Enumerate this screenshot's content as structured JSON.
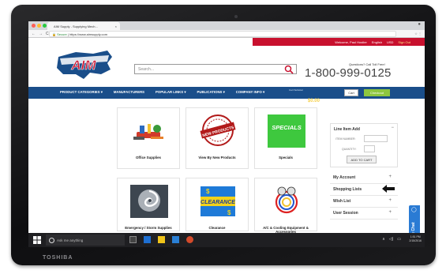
{
  "device": {
    "brand": "TOSHIBA"
  },
  "browser": {
    "tab_title": "AIM Supply - Supplying Mech...",
    "tab_close": "×",
    "url_secure": "Secure",
    "url": "https://www.aimsupply.com",
    "nav_back": "←",
    "nav_forward": "→",
    "nav_reload": "C"
  },
  "header": {
    "welcome": "Welcome, Paul Hostler",
    "language": "English",
    "currency": "USD",
    "sign_out": "Sign Out",
    "search_placeholder": "Search...",
    "call_label": "Questions? Call Toll Free!",
    "phone": "1-800-999-0125"
  },
  "nav": {
    "items": [
      {
        "label": "PRODUCT CATEGORIES ▾"
      },
      {
        "label": "MANUFACTURERS"
      },
      {
        "label": "POPULAR LINKS ▾"
      },
      {
        "label": "PUBLICATIONS ▾"
      },
      {
        "label": "COMPANY INFO ▾"
      }
    ],
    "cart_label": "Cart Subtotal",
    "cart_items": "0 item(s)",
    "cart_total": "$0.00",
    "cart_button": "Cart",
    "checkout_button": "Checkout"
  },
  "products": [
    {
      "caption": "Office Supplies"
    },
    {
      "caption": "View By New Products",
      "badge": "NEW PRODUCTS"
    },
    {
      "caption": "Specials",
      "badge": "SPECIALS"
    },
    {
      "caption": "Emergency / Storm Supplies"
    },
    {
      "caption": "Clearance",
      "badge": "CLEARANCE"
    },
    {
      "caption": "A/C & Cooling Equipment & Accessories"
    }
  ],
  "sidebar": {
    "line_item_title": "Line Item Add",
    "item_label": "ITEM NUMBER:",
    "qty_label": "QUANTITY:",
    "add_button": "ADD TO CART",
    "menu": [
      {
        "label": "My Account",
        "plus": "+"
      },
      {
        "label": "Shopping Lists",
        "plus": ""
      },
      {
        "label": "Wish List",
        "plus": "+"
      },
      {
        "label": "User Session",
        "plus": "+"
      }
    ]
  },
  "livechat": {
    "label": "Live Chat"
  },
  "taskbar": {
    "search_text": "Ask me anything",
    "time": "1:51 PM",
    "date": "2/15/2016"
  },
  "colors": {
    "brand_red": "#c8102e",
    "nav_blue": "#1a4e8a",
    "checkout_green": "#8dc63f",
    "specials_green": "#3ec83e"
  }
}
